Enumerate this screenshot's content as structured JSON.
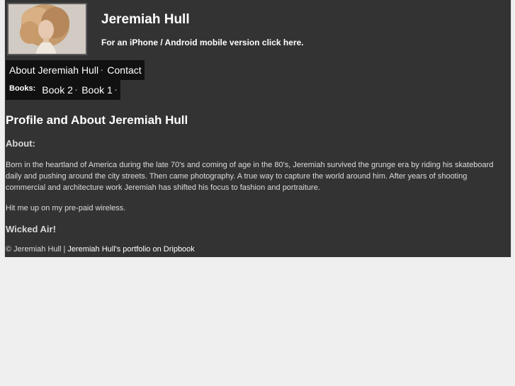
{
  "header": {
    "title": "Jeremiah Hull",
    "mobile_link": "For an iPhone / Android mobile version click here."
  },
  "nav": {
    "items": [
      {
        "label": "About Jeremiah Hull",
        "sep": "-"
      },
      {
        "label": "Contact"
      }
    ]
  },
  "books_nav": {
    "label": "Books:",
    "items": [
      {
        "label": "Book 2",
        "sep": "-"
      },
      {
        "label": "Book 1",
        "sep": "-"
      }
    ]
  },
  "main": {
    "title": "Profile and About Jeremiah Hull",
    "about_heading": "About:",
    "about_text": "Born in the heartland of America during the late 70's and coming of age in the 80's, Jeremiah survived the grunge era by riding his skateboard daily and pushing around the city streets. Then came photography. A true way to capture the world around him. After years of shooting commercial and architecture work Jeremiah has shifted his focus to fashion and portraiture.",
    "contact_text": "Hit me up on my pre-paid wireless.",
    "wicked_heading": "Wicked Air!"
  },
  "footer": {
    "copyright": "© Jeremiah Hull | ",
    "portfolio_link": "Jeremiah Hull's portfolio on Dripbook"
  },
  "colors": {
    "page_bg": "#333333",
    "outer_bg": "#efefef",
    "nav_bg": "#111111"
  }
}
